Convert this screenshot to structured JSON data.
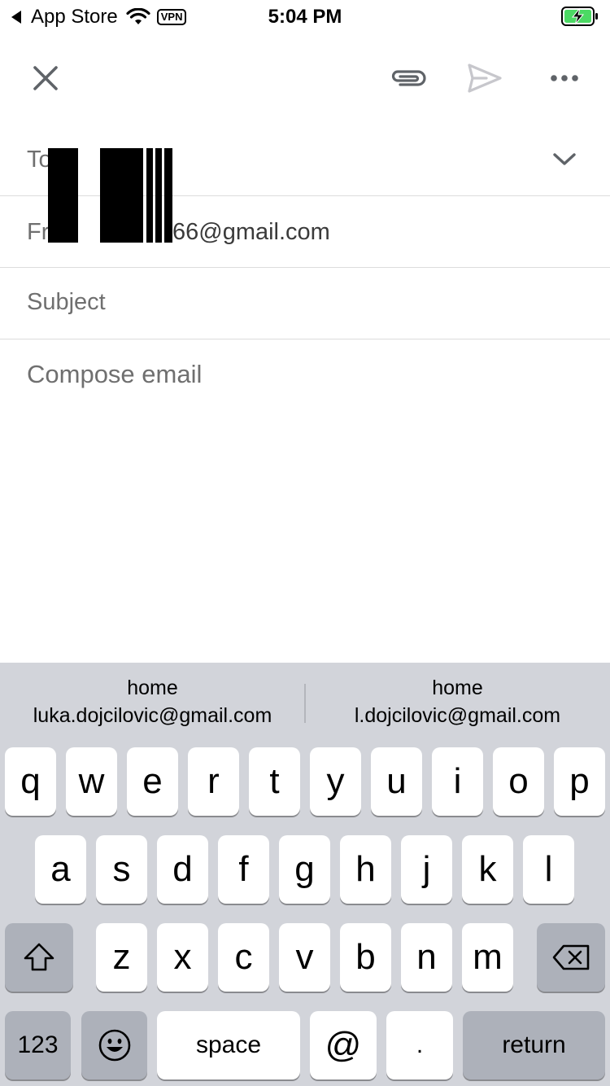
{
  "status_bar": {
    "back_app": "App Store",
    "vpn": "VPN",
    "time": "5:04 PM"
  },
  "toolbar": {
    "close_icon": "close-icon",
    "attach_icon": "paperclip-icon",
    "send_icon": "send-icon",
    "more_icon": "more-horizontal-icon"
  },
  "fields": {
    "to_label": "To",
    "from_label": "Fr",
    "from_value": "66@gmail.com",
    "subject_placeholder": "Subject",
    "body_placeholder": "Compose email"
  },
  "keyboard": {
    "suggestions": [
      {
        "label": "home",
        "email": "luka.dojcilovic@gmail.com"
      },
      {
        "label": "home",
        "email": "l.dojcilovic@gmail.com"
      }
    ],
    "row1": [
      "q",
      "w",
      "e",
      "r",
      "t",
      "y",
      "u",
      "i",
      "o",
      "p"
    ],
    "row2": [
      "a",
      "s",
      "d",
      "f",
      "g",
      "h",
      "j",
      "k",
      "l"
    ],
    "row3": [
      "z",
      "x",
      "c",
      "v",
      "b",
      "n",
      "m"
    ],
    "numbers_label": "123",
    "space_label": "space",
    "at_label": "@",
    "period_label": ".",
    "return_label": "return"
  },
  "colors": {
    "battery_fill": "#4cd964",
    "keyboard_bg": "#d2d4da",
    "gray_key": "#adb1ba",
    "placeholder": "#6f6f6f"
  }
}
